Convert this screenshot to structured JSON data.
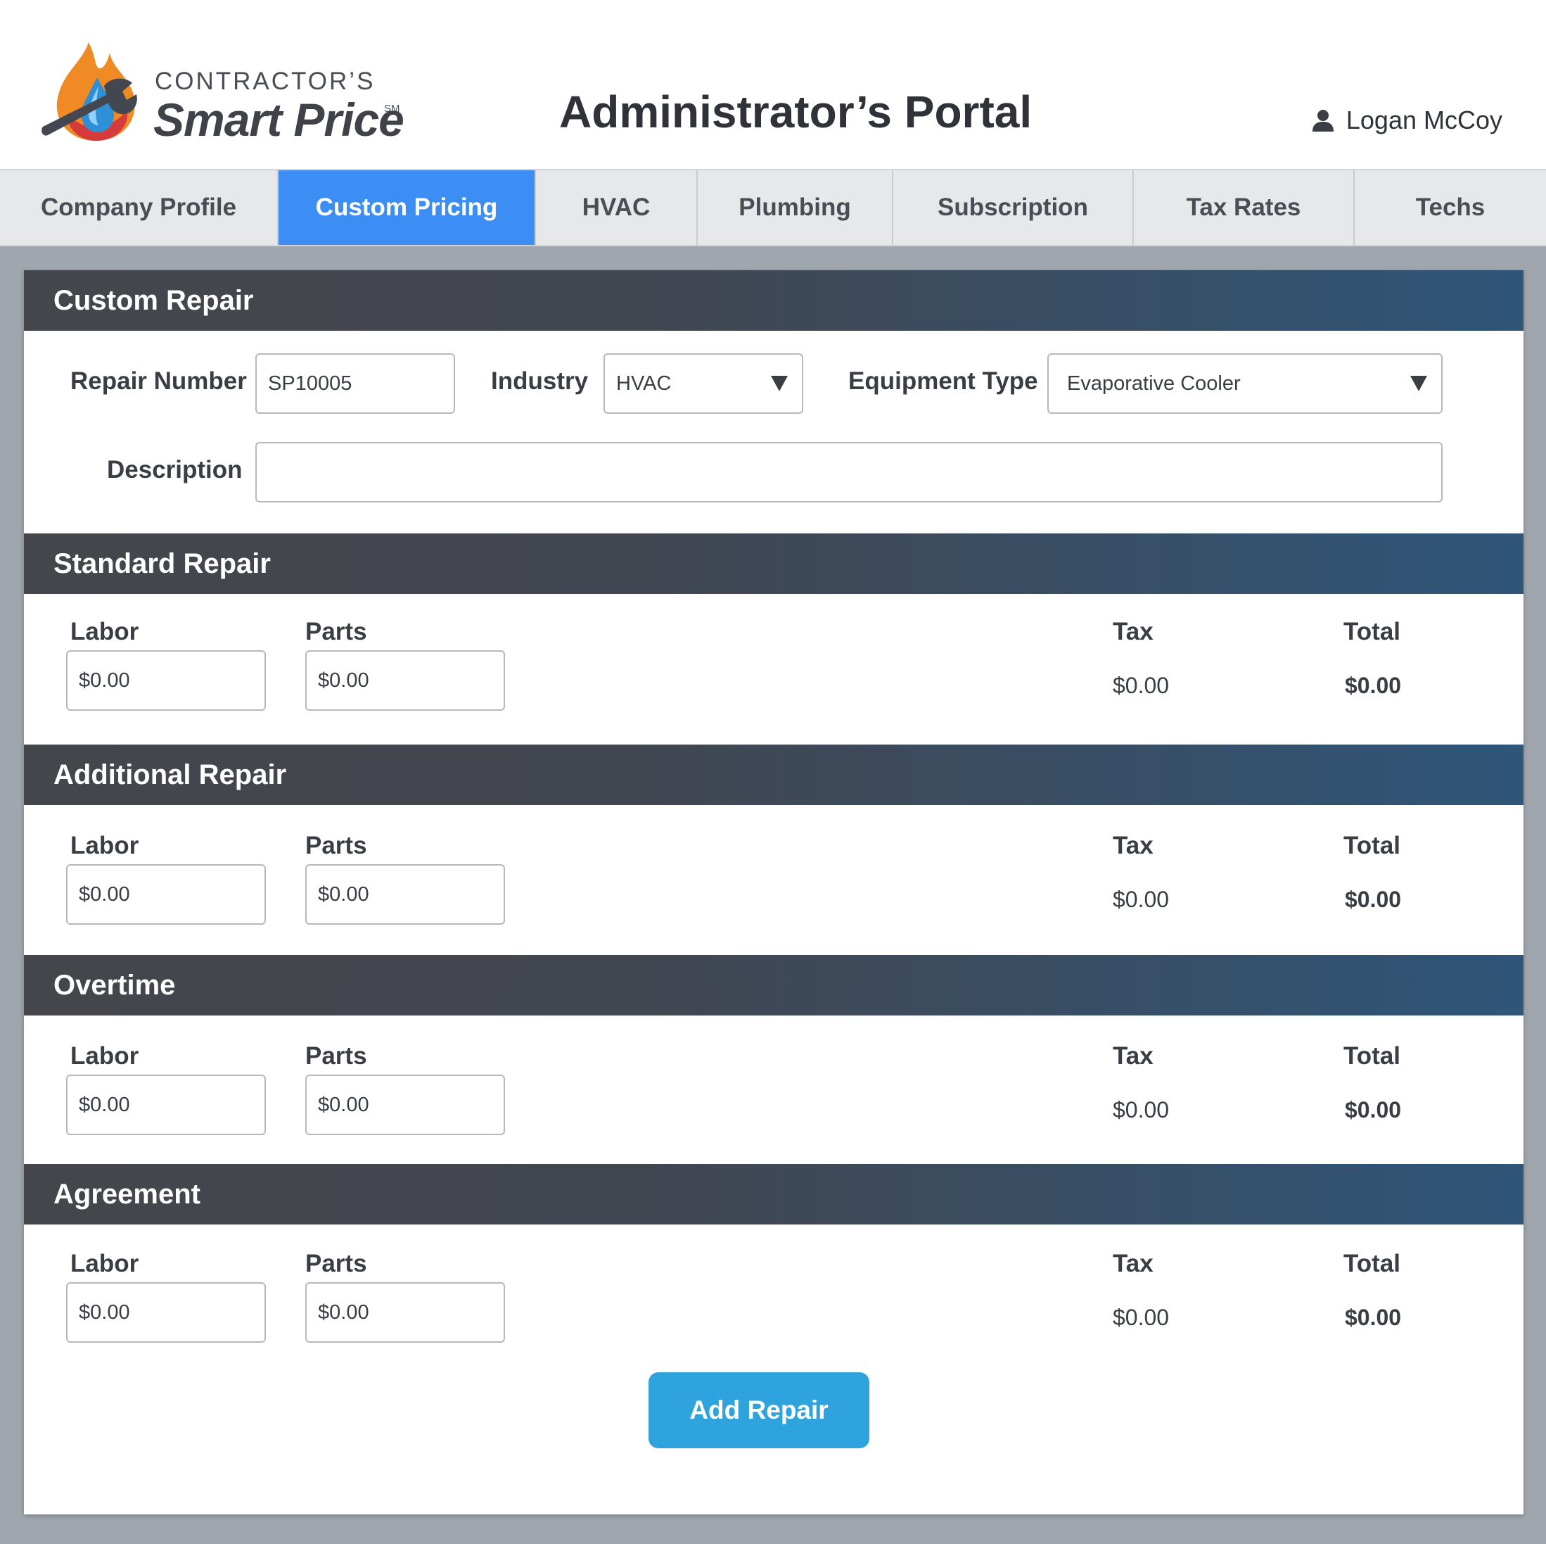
{
  "brand": {
    "top_line": "CONTRACTOR’S",
    "main_line": "Smart Price",
    "mark": "SM",
    "logo_icon": "wrench-flame-drop-icon"
  },
  "header": {
    "title": "Administrator’s Portal",
    "user_name": "Logan McCoy",
    "user_icon": "user-icon"
  },
  "tabs": [
    {
      "label": "Company Profile",
      "active": false
    },
    {
      "label": "Custom Pricing",
      "active": true
    },
    {
      "label": "HVAC",
      "active": false
    },
    {
      "label": "Plumbing",
      "active": false
    },
    {
      "label": "Subscription",
      "active": false
    },
    {
      "label": "Tax Rates",
      "active": false
    },
    {
      "label": "Techs",
      "active": false
    }
  ],
  "custom_repair": {
    "heading": "Custom Repair",
    "repair_number_label": "Repair Number",
    "repair_number_value": "SP10005",
    "industry_label": "Industry",
    "industry_value": "HVAC",
    "equipment_type_label": "Equipment Type",
    "equipment_type_value": "Evaporative Cooler",
    "description_label": "Description",
    "description_value": ""
  },
  "sections": [
    {
      "heading": "Standard Repair",
      "labor_label": "Labor",
      "labor_value": "$0.00",
      "parts_label": "Parts",
      "parts_value": "$0.00",
      "tax_label": "Tax",
      "tax_value": "$0.00",
      "total_label": "Total",
      "total_value": "$0.00"
    },
    {
      "heading": "Additional Repair",
      "labor_label": "Labor",
      "labor_value": "$0.00",
      "parts_label": "Parts",
      "parts_value": "$0.00",
      "tax_label": "Tax",
      "tax_value": "$0.00",
      "total_label": "Total",
      "total_value": "$0.00"
    },
    {
      "heading": "Overtime",
      "labor_label": "Labor",
      "labor_value": "$0.00",
      "parts_label": "Parts",
      "parts_value": "$0.00",
      "tax_label": "Tax",
      "tax_value": "$0.00",
      "total_label": "Total",
      "total_value": "$0.00"
    },
    {
      "heading": "Agreement",
      "labor_label": "Labor",
      "labor_value": "$0.00",
      "parts_label": "Parts",
      "parts_value": "$0.00",
      "tax_label": "Tax",
      "tax_value": "$0.00",
      "total_label": "Total",
      "total_value": "$0.00"
    }
  ],
  "actions": {
    "add_repair_label": "Add Repair"
  },
  "colors": {
    "active_tab": "#3d8ef4",
    "section_bar_start": "#45464c",
    "section_bar_end": "#2f5578",
    "button": "#2fa3dd",
    "background": "#9fa6ae"
  }
}
